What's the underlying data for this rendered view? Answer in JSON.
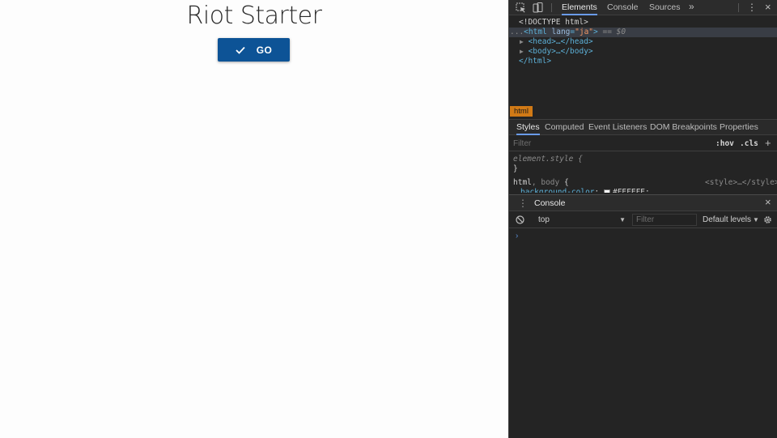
{
  "page": {
    "title": "Riot Starter",
    "go_button": {
      "label": "GO",
      "icon": "check-icon"
    }
  },
  "devtools": {
    "toolbar": {
      "inspect_icon": "inspect-element-icon",
      "device_icon": "device-toolbar-icon",
      "tabs": [
        "Elements",
        "Console",
        "Sources"
      ],
      "active_tab": "Elements",
      "more_tabs": "»",
      "menu_icon": "⋮",
      "close_icon": "×"
    },
    "dom": {
      "doctype": "<!DOCTYPE html>",
      "html_prefix": "...",
      "html_open": "<html ",
      "html_attr_name": "lang",
      "html_attr_eq": "=",
      "html_attr_value": "\"ja\"",
      "html_open_end": ">",
      "selected_marker": " == $0",
      "head": "<head>…</head>",
      "body": "<body>…</body>",
      "html_close": "</html>"
    },
    "breadcrumb": "html",
    "styles_tabs": [
      "Styles",
      "Computed",
      "Event Listeners",
      "DOM Breakpoints",
      "Properties"
    ],
    "styles_active": "Styles",
    "filter": {
      "placeholder": "Filter",
      "hov": ":hov",
      "cls": ".cls",
      "add": "+"
    },
    "rules": {
      "element_style_open": "element.style {",
      "element_style_close": "}",
      "selector_html": "html",
      "selector_sep": ", ",
      "selector_body": "body",
      "selector_open": " {",
      "source": "<style>…</style>",
      "prop": "background-color",
      "prop_sep": ": ",
      "value": "#FEFEFE",
      "value_end": ";"
    },
    "console": {
      "drawer_title": "Console",
      "drawer_menu": "⋮",
      "drawer_close": "×",
      "context": "top",
      "filter_placeholder": "Filter",
      "levels": "Default levels",
      "prompt": "›",
      "dropdown_arrow": "▼"
    }
  }
}
